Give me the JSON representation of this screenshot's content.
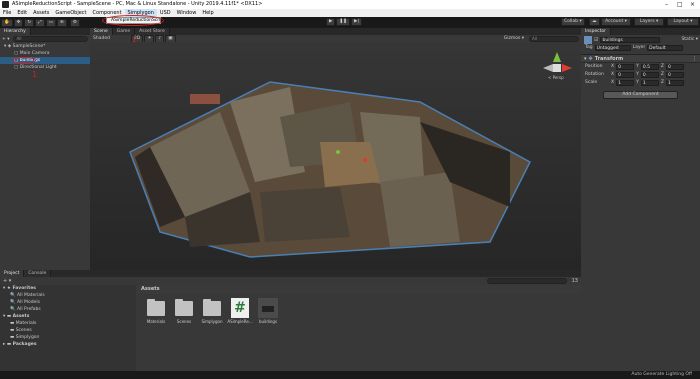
{
  "title_bar": {
    "text": "ASimpleReductionScript - SampleScene - PC, Mac & Linux Standalone - Unity 2019.4.11f1* <DX11>"
  },
  "menu": {
    "items": [
      "File",
      "Edit",
      "Assets",
      "GameObject",
      "Component",
      "Simplygon",
      "USD",
      "Window",
      "Help"
    ],
    "dropdown_item": "ASimpleReductionScript"
  },
  "toolbar": {
    "collab": "Collab ▾",
    "account": "Account ▾",
    "layers": "Layers ▾",
    "layout": "Layout ▾"
  },
  "hierarchy": {
    "tab": "Hierarchy",
    "create": "+ ▾",
    "search_placeholder": "All",
    "items": [
      {
        "label": "SampleScene*",
        "depth": 0
      },
      {
        "label": "Main Camera",
        "depth": 1
      },
      {
        "label": "buildings",
        "depth": 1,
        "selected": true
      },
      {
        "label": "Directional Light",
        "depth": 1
      }
    ],
    "annotation": "1"
  },
  "scene": {
    "tabs": [
      "Scene",
      "Game",
      "Asset Store"
    ],
    "shading": "Shaded",
    "mode": "2D",
    "gizmos": "Gizmos ▾",
    "search": "All",
    "persp": "< Persp",
    "annotation": "2"
  },
  "inspector": {
    "tab": "Inspector",
    "object_name": "buildings",
    "static": "Static ▾",
    "tag_label": "Tag",
    "tag": "Untagged",
    "layer_label": "Layer",
    "layer": "Default",
    "component": "Transform",
    "rows": [
      {
        "label": "Position",
        "x": "0",
        "y": "0.5",
        "z": "0"
      },
      {
        "label": "Rotation",
        "x": "0",
        "y": "0",
        "z": "0"
      },
      {
        "label": "Scale",
        "x": "1",
        "y": "1",
        "z": "1"
      }
    ],
    "add_component": "Add Component"
  },
  "project": {
    "tabs": [
      "Project",
      "Console"
    ],
    "create": "+ ▾",
    "header": "Assets",
    "tree": [
      {
        "label": "Favorites",
        "depth": 0
      },
      {
        "label": "All Materials",
        "depth": 1
      },
      {
        "label": "All Models",
        "depth": 1
      },
      {
        "label": "All Prefabs",
        "depth": 1
      },
      {
        "label": "Assets",
        "depth": 0
      },
      {
        "label": "Materials",
        "depth": 1
      },
      {
        "label": "Scenes",
        "depth": 1
      },
      {
        "label": "Simplygon",
        "depth": 1
      },
      {
        "label": "Packages",
        "depth": 0
      }
    ],
    "assets": [
      "Materials",
      "Scenes",
      "Simplygon",
      "ASimpleRe...",
      "buildings"
    ],
    "count": "13"
  },
  "status": {
    "right": "Auto Generate Lighting Off"
  },
  "colors": {
    "selection": "#2c5d87",
    "annotation": "#d02020",
    "gizmo_x": "#e33b2e",
    "gizmo_y": "#7bc043",
    "gizmo_z": "#3a7fe0"
  }
}
